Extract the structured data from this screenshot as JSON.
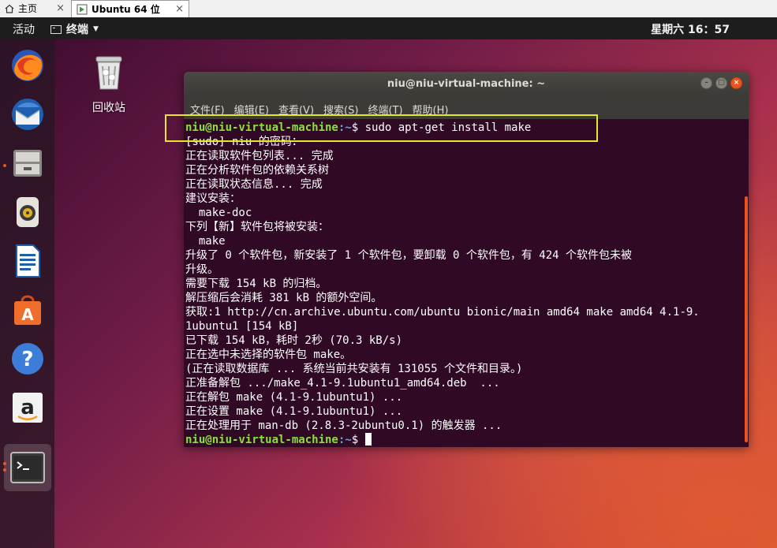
{
  "vm_tabs": [
    {
      "label": "主页",
      "icon": "home-icon"
    },
    {
      "label": "Ubuntu 64 位",
      "icon": "vm-icon"
    }
  ],
  "topbar": {
    "activities": "活动",
    "app_menu": "终端",
    "clock": "星期六 16：57"
  },
  "dock": [
    {
      "name": "firefox-icon"
    },
    {
      "name": "thunderbird-icon"
    },
    {
      "name": "files-icon"
    },
    {
      "name": "rhythmbox-icon"
    },
    {
      "name": "libreoffice-writer-icon"
    },
    {
      "name": "software-center-icon"
    },
    {
      "name": "help-icon"
    },
    {
      "name": "amazon-icon"
    },
    {
      "name": "terminal-icon"
    }
  ],
  "desktop": {
    "trash_label": "回收站"
  },
  "window": {
    "title": "niu@niu-virtual-machine: ~",
    "menus": [
      "文件(F)",
      "编辑(E)",
      "查看(V)",
      "搜索(S)",
      "终端(T)",
      "帮助(H)"
    ]
  },
  "terminal": {
    "prompt_user": "niu@niu-virtual-machine",
    "prompt_path": ":~",
    "prompt_symbol": "$",
    "command": " sudo apt-get install make",
    "output": [
      "[sudo] niu 的密码：",
      "正在读取软件包列表... 完成",
      "正在分析软件包的依赖关系树",
      "正在读取状态信息... 完成",
      "建议安装：",
      "  make-doc",
      "下列【新】软件包将被安装：",
      "  make",
      "升级了 0 个软件包，新安装了 1 个软件包，要卸载 0 个软件包，有 424 个软件包未被",
      "升级。",
      "需要下载 154 kB 的归档。",
      "解压缩后会消耗 381 kB 的额外空间。",
      "获取:1 http://cn.archive.ubuntu.com/ubuntu bionic/main amd64 make amd64 4.1-9.",
      "1ubuntu1 [154 kB]",
      "已下载 154 kB，耗时 2秒 (70.3 kB/s)",
      "正在选中未选择的软件包 make。",
      "(正在读取数据库 ... 系统当前共安装有 131055 个文件和目录。)",
      "正准备解包 .../make_4.1-9.1ubuntu1_amd64.deb  ...",
      "正在解包 make (4.1-9.1ubuntu1) ...",
      "正在设置 make (4.1-9.1ubuntu1) ...",
      "正在处理用于 man-db (2.8.3-2ubuntu0.1) 的触发器 ..."
    ]
  },
  "colors": {
    "accent": "#e95420",
    "terminal_bg": "#300a24",
    "prompt_user": "#8ae234",
    "prompt_path": "#729fcf",
    "highlight_box": "#e6e62a"
  }
}
